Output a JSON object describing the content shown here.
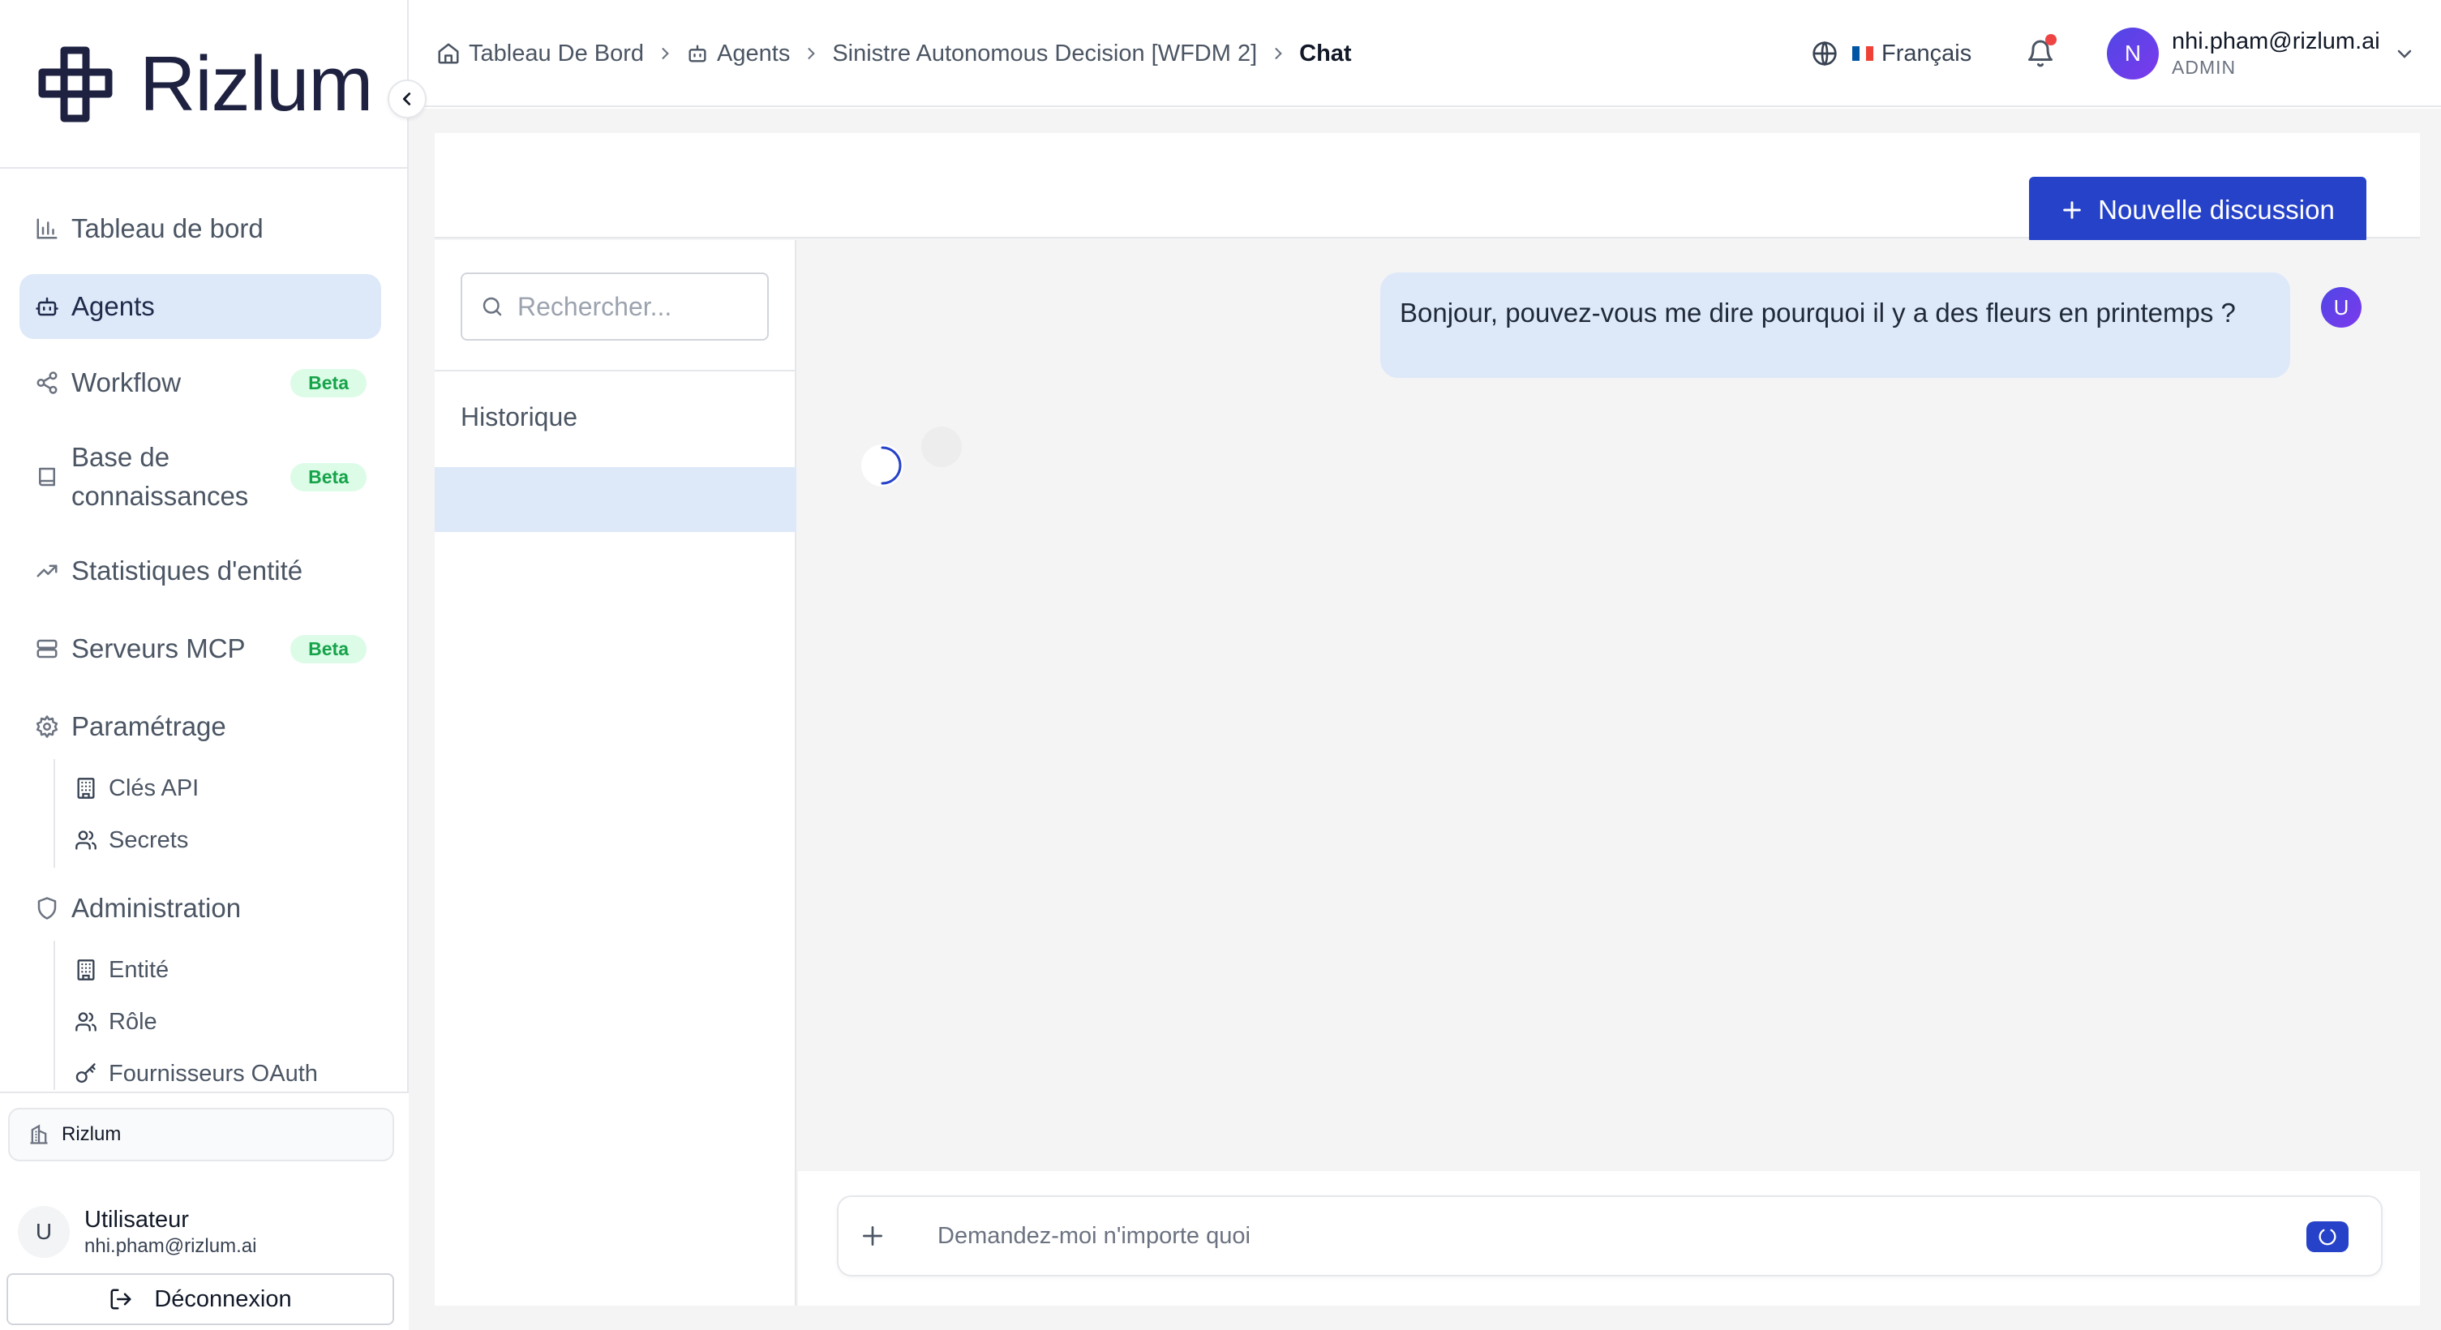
{
  "brand": {
    "name": "Rizlum",
    "color": "#1e2140"
  },
  "colors": {
    "accent": "#2642c8",
    "active_bg": "#dde8f9",
    "badge_bg": "#dcfce7",
    "badge_text": "#16a34a",
    "notification_dot": "#ef4444"
  },
  "sidebar": {
    "items": [
      {
        "label": "Tableau de bord",
        "icon": "bar-chart-icon"
      },
      {
        "label": "Agents",
        "icon": "bot-icon",
        "active": true
      },
      {
        "label": "Workflow",
        "icon": "share-icon",
        "badge": "Beta"
      },
      {
        "label": "Base de connaissances",
        "icon": "book-icon",
        "badge": "Beta"
      },
      {
        "label": "Statistiques d'entité",
        "icon": "trending-up-icon"
      },
      {
        "label": "Serveurs MCP",
        "icon": "server-icon",
        "badge": "Beta"
      },
      {
        "label": "Paramétrage",
        "icon": "gear-icon"
      },
      {
        "label": "Administration",
        "icon": "shield-icon"
      }
    ],
    "settings_sub": [
      {
        "label": "Clés API",
        "icon": "building-icon"
      },
      {
        "label": "Secrets",
        "icon": "users-icon"
      }
    ],
    "admin_sub": [
      {
        "label": "Entité",
        "icon": "building-icon"
      },
      {
        "label": "Rôle",
        "icon": "users-icon"
      },
      {
        "label": "Fournisseurs OAuth",
        "icon": "key-icon"
      }
    ],
    "footer": {
      "org": "Rizlum",
      "user_initial": "U",
      "user_name": "Utilisateur",
      "user_email": "nhi.pham@rizlum.ai",
      "logout_label": "Déconnexion"
    }
  },
  "header": {
    "breadcrumb": [
      "Tableau De Bord",
      "Agents",
      "Sinistre Autonomous Decision [WFDM 2]",
      "Chat"
    ],
    "language": "Français",
    "user_initial": "N",
    "user_email": "nhi.pham@rizlum.ai",
    "user_role": "ADMIN",
    "has_notification": true
  },
  "main": {
    "new_chat_label": "Nouvelle discussion",
    "search_placeholder": "Rechercher...",
    "history_title": "Historique",
    "messages": [
      {
        "role": "user",
        "avatar": "U",
        "text": "Bonjour, pouvez-vous me dire pourquoi il y a des fleurs en printemps ?"
      }
    ],
    "assistant_loading": true,
    "composer_placeholder": "Demandez-moi n'importe quoi"
  }
}
